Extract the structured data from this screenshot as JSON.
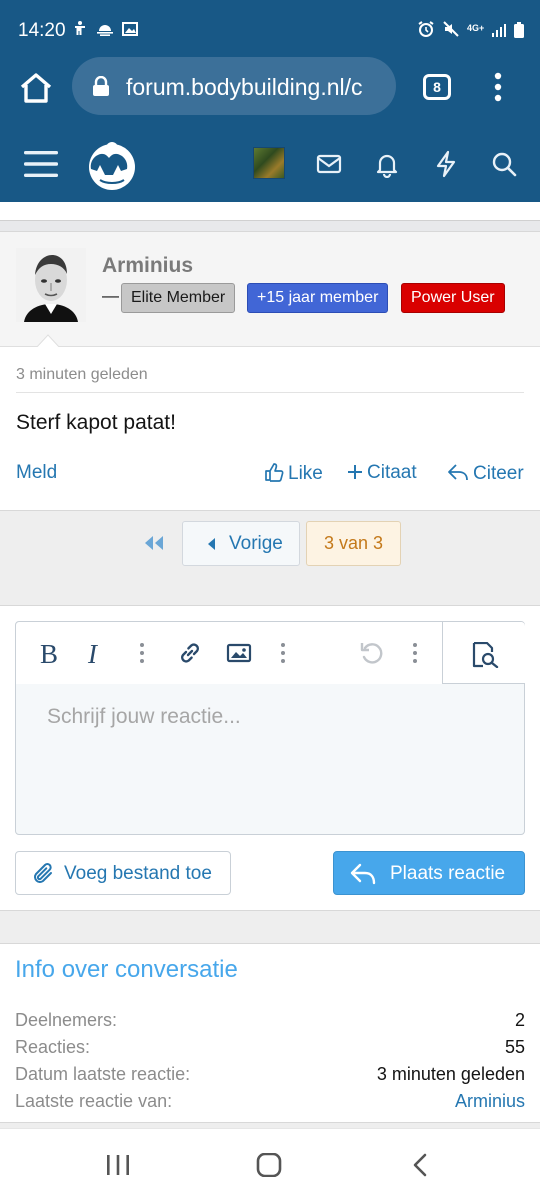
{
  "status_bar": {
    "time": "14:20",
    "left_icons": [
      "accessibility-icon",
      "weather-icon",
      "image-icon"
    ],
    "right_icons": [
      "alarm-icon",
      "mute-icon",
      "4g-icon",
      "signal-icon",
      "battery-icon"
    ],
    "network": "4G+"
  },
  "browser": {
    "url": "forum.bodybuilding.nl/c",
    "tab_count": "8"
  },
  "header": {
    "icons": [
      "menu-icon",
      "logo",
      "user-avatar",
      "mail-icon",
      "bell-icon",
      "bolt-icon",
      "search-icon"
    ]
  },
  "post": {
    "username": "Arminius",
    "dash": "—",
    "badges": [
      "Elite Member",
      "+15 jaar member",
      "Power User"
    ],
    "date": "3 minuten geleden",
    "body": "Sterf kapot patat!",
    "actions": {
      "report": "Meld",
      "like": "Like",
      "quote_add": "Citaat",
      "quote": "Citeer"
    }
  },
  "pagination": {
    "prev_label": "Vorige",
    "current": "3 van 3"
  },
  "editor": {
    "placeholder": "Schrijf jouw reactie...",
    "bold": "B",
    "italic": "I",
    "attach_label": "Voeg bestand toe",
    "submit_label": "Plaats reactie"
  },
  "info": {
    "title": "Info over conversatie",
    "rows": [
      {
        "label": "Deelnemers:",
        "value": "2"
      },
      {
        "label": "Reacties:",
        "value": "55"
      },
      {
        "label": "Datum laatste reactie:",
        "value": "3 minuten geleden"
      },
      {
        "label": "Laatste reactie van:",
        "value": "Arminius"
      }
    ]
  },
  "colors": {
    "brand": "#185886",
    "link": "#2577b1",
    "accent": "#47a7eb",
    "badge_elite": "#c7c7c7",
    "badge_member": "#4166d6",
    "badge_power": "#d90000"
  }
}
